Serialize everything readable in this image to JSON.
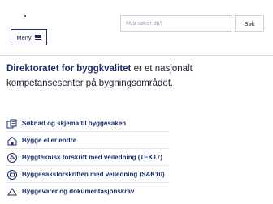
{
  "header": {
    "search": {
      "placeholder": "Hva søker du?",
      "button_label": "Søk"
    },
    "menu_label": "Meny"
  },
  "intro": {
    "bold_part": "Direktoratet for byggkvalitet",
    "rest": " er et nasjonalt kompetansesenter på bygningsområdet."
  },
  "links": [
    {
      "label": "Søknad og skjema til byggesaken",
      "icon": "forms-icon"
    },
    {
      "label": "Bygge eller endre",
      "icon": "house-icon"
    },
    {
      "label": "Byggteknisk forskrift med veiledning (TEK17)",
      "icon": "regulation-icon"
    },
    {
      "label": "Byggesaksforskriften med veiledning (SAK10)",
      "icon": "case-icon"
    },
    {
      "label": "Byggevarer og dokumentasjonskrav",
      "icon": "products-icon"
    }
  ],
  "colors": {
    "brand": "#1b2a6b",
    "text": "#1a1a2e"
  }
}
